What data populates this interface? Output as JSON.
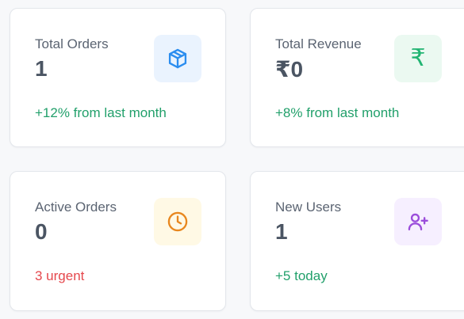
{
  "cards": [
    {
      "title": "Total Orders",
      "value": "1",
      "trend": "+12% from last month",
      "trend_color": "#22a06b",
      "icon": "package-icon",
      "icon_color": "#2b8def",
      "icon_bg": "#eaf3fe"
    },
    {
      "title": "Total Revenue",
      "value": "₹0",
      "trend": "+8% from last month",
      "trend_color": "#22a06b",
      "icon": "rupee-icon",
      "icon_glyph": "₹",
      "icon_color": "#22b573",
      "icon_bg": "#ebf9f1"
    },
    {
      "title": "Active Orders",
      "value": "0",
      "trend": "3 urgent",
      "trend_color": "#e5484d",
      "icon": "clock-icon",
      "icon_color": "#e8871e",
      "icon_bg": "#fff9e5"
    },
    {
      "title": "New Users",
      "value": "1",
      "trend": "+5 today",
      "trend_color": "#22a06b",
      "icon": "user-plus-icon",
      "icon_color": "#9b4ddb",
      "icon_bg": "#f6efff"
    }
  ]
}
